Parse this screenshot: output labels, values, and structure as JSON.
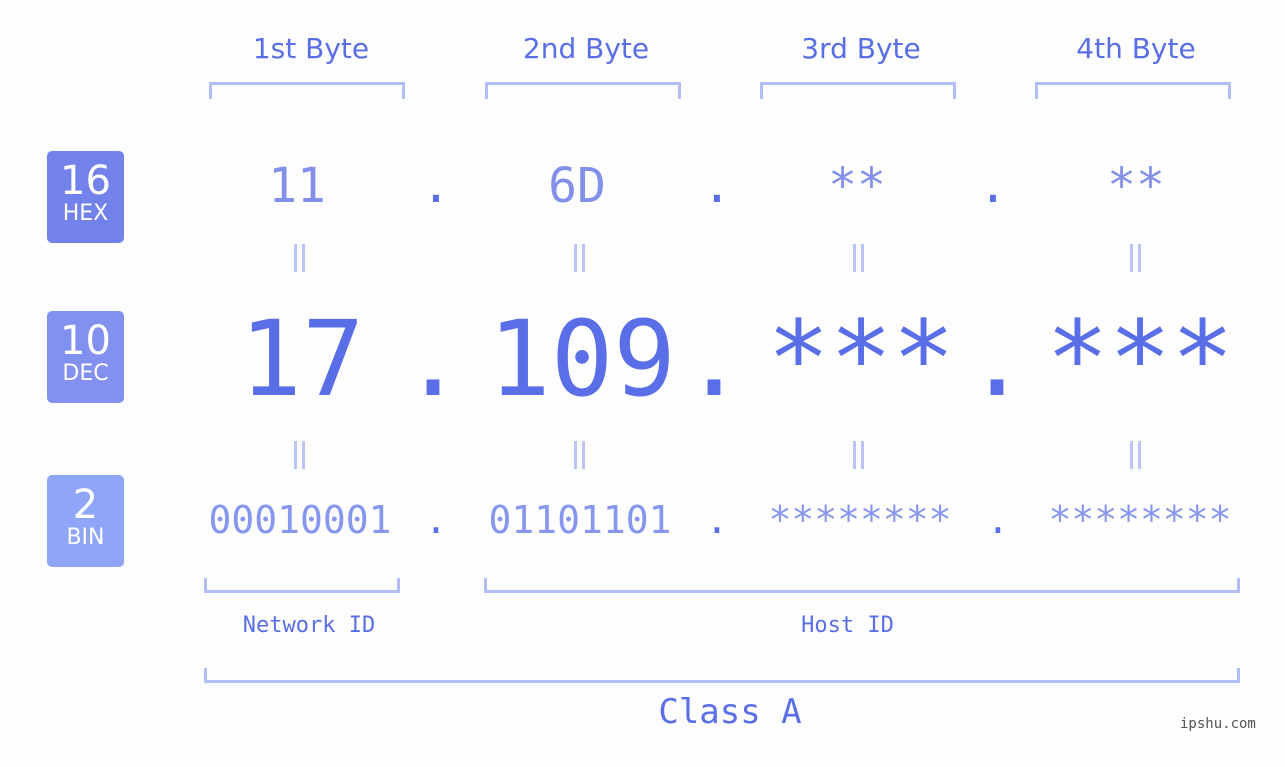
{
  "headers": [
    "1st Byte",
    "2nd Byte",
    "3rd Byte",
    "4th Byte"
  ],
  "badges": [
    {
      "number": "16",
      "label": "HEX",
      "color": "#7381ea"
    },
    {
      "number": "10",
      "label": "DEC",
      "color": "#8291f0"
    },
    {
      "number": "2",
      "label": "BIN",
      "color": "#8fa5f8"
    }
  ],
  "hex": [
    "11",
    "6D",
    "**",
    "**"
  ],
  "dec": [
    "17",
    "109",
    "***",
    "***"
  ],
  "bin": [
    "00010001",
    "01101101",
    "********",
    "********"
  ],
  "separator": ".",
  "labels": {
    "network": "Network ID",
    "host": "Host ID",
    "class": "Class A"
  },
  "watermark": "ipshu.com"
}
